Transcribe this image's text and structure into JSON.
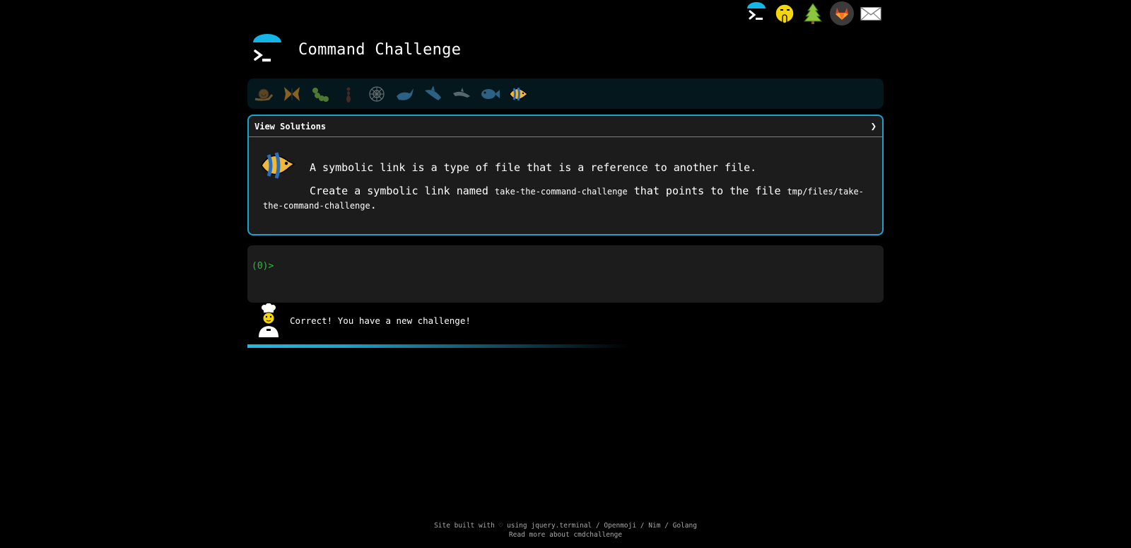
{
  "header": {
    "title": "Command Challenge"
  },
  "top_nav": [
    {
      "name": "terminal-icon"
    },
    {
      "name": "shushing-face-icon"
    },
    {
      "name": "tree-icon"
    },
    {
      "name": "gitlab-icon"
    },
    {
      "name": "mail-icon"
    }
  ],
  "levels": [
    {
      "name": "snail-icon"
    },
    {
      "name": "butterfly-icon"
    },
    {
      "name": "caterpillar-icon"
    },
    {
      "name": "ant-icon"
    },
    {
      "name": "web-icon"
    },
    {
      "name": "whale-icon"
    },
    {
      "name": "shark-icon"
    },
    {
      "name": "dolphin-icon"
    },
    {
      "name": "fish-icon"
    },
    {
      "name": "tropical-fish-icon"
    }
  ],
  "panel": {
    "toggle_label": "View Solutions",
    "chevron": "❯",
    "line1": "A symbolic link is a type of file that is a reference to another file.",
    "line2_a": "Create a symbolic link named ",
    "link_name": "take-the-command-challenge",
    "line2_b": " that points to the file ",
    "target_path": "tmp/files/take-the-command-challenge",
    "line2_c": "."
  },
  "terminal": {
    "prompt": "(0)>"
  },
  "status": {
    "message": "Correct! You have a new challenge!"
  },
  "footer": {
    "line1_prefix": "Site built with ♡ using ",
    "link_jquery": "jquery.terminal",
    "sep": " / ",
    "link_openmoji": "Openmoji",
    "link_nim": "Nim",
    "link_golang": "Golang",
    "line2": "Read more about cmdchallenge"
  },
  "colors": {
    "accent": "#1aa3cc",
    "prompt": "#2bbf3a",
    "panel_bg": "#1c1c1c",
    "level_bg": "#04171d"
  }
}
